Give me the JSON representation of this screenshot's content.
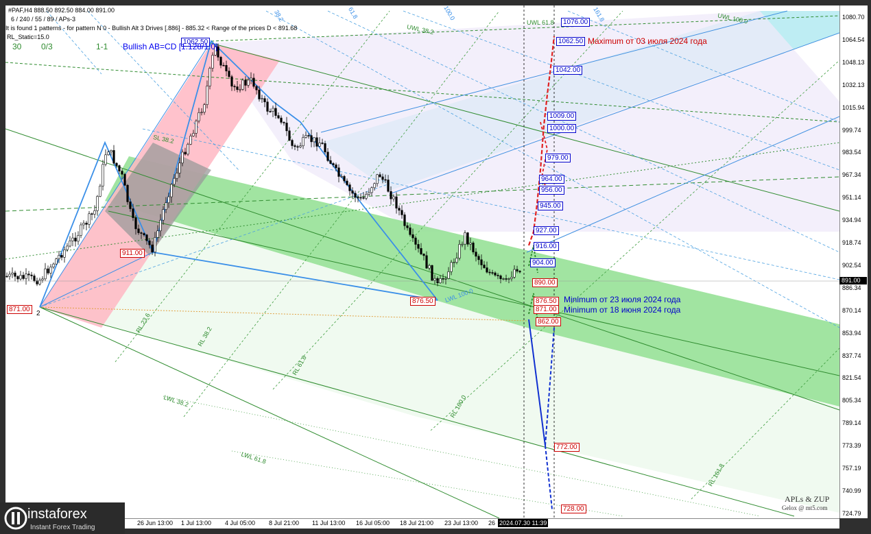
{
  "header": {
    "symbol_line": "#PAF,H4  888.50 892.50 884.00 891.00",
    "settings_line": "6 / 240 / 55 / 89 / APs-3",
    "pattern_line": "It is found 1 patterns  -  for pattern N 0 - Bullish Alt 3 Drives [.886] - 885.32 < Range of the prices D < 891.68",
    "static_line": "RL_Static=15.0",
    "counter_1": "30",
    "counter_2": "0/3",
    "counter_3": "1-1",
    "pattern_title": "Bullish AB=CD [1.128/1.0]"
  },
  "y_axis": {
    "ticks": [
      "1080.70",
      "1064.54",
      "1048.13",
      "1032.13",
      "1015.94",
      "999.74",
      "983.54",
      "967.34",
      "951.14",
      "934.94",
      "918.74",
      "902.54",
      "886.34",
      "870.14",
      "853.94",
      "837.74",
      "821.54",
      "805.34",
      "789.14",
      "773.39",
      "757.19",
      "740.99",
      "724.79"
    ],
    "current_price": "891.00"
  },
  "x_axis": {
    "ticks": [
      "00",
      "26 Jun 13:00",
      "1 Jul 13:00",
      "4 Jul 05:00",
      "8 Jul 21:00",
      "11 Jul 13:00",
      "16 Jul 05:00",
      "18 Jul 21:00",
      "23 Jul 13:00",
      "26"
    ],
    "current_time": "2024.07.30 11:39"
  },
  "levels": {
    "blue": [
      "1076.00",
      "1062.50",
      "1042.00",
      "1009.00",
      "1000.00",
      "979.00",
      "964.00",
      "956.00",
      "945.00",
      "927.00",
      "916.00",
      "904.00"
    ],
    "red": [
      "890.00",
      "876.50",
      "871.00",
      "862.00",
      "772.00",
      "728.00"
    ],
    "chart_marks": [
      "1062.50",
      "911.00",
      "871.00",
      "876.50"
    ],
    "pivot_label": "2"
  },
  "notes": {
    "max_note": "Maximum от 03 июля 2024 года",
    "min_note_1": "Minimum от 23 июля 2024 года",
    "min_note_2": "Minimum от 18 июня 2024 года"
  },
  "line_labels": [
    "UWL 100.0",
    "UWL 61.8",
    "UWL 38.2",
    "SL 38.2",
    "RL 23.6",
    "RL 38.2",
    "RL 61.8",
    "RL 100.0",
    "LWL 38.2",
    "LWL 61.8",
    "LWL 100.0",
    "RL 161.8",
    "61.8",
    "100.0",
    "161.8",
    "38.2"
  ],
  "watermark": {
    "title": "APLs & ZUP",
    "sub": "Gelox @ mt5.com"
  },
  "brand": {
    "name": "instaforex",
    "tagline": "Instant Forex Trading"
  },
  "colors": {
    "blue_level": "#0000cc",
    "red_level": "#cc0000",
    "channel_green": "#6fd36f",
    "channel_cyan": "#8ee3ee",
    "pink_zone": "#ff9fb0",
    "bull_candle": "#ffffff",
    "bear_candle": "#000000"
  },
  "chart_data": {
    "type": "candlestick",
    "symbol": "#PAF",
    "timeframe": "H4",
    "ohlc_last": {
      "open": 888.5,
      "high": 892.5,
      "low": 884.0,
      "close": 891.0
    },
    "ylim": [
      724.79,
      1080.7
    ],
    "swing_points": [
      {
        "date": "18 Jun",
        "value": 871.0
      },
      {
        "date": "25 Jun",
        "value": 911.0
      },
      {
        "date": "3 Jul",
        "value": 1062.5
      },
      {
        "date": "23 Jul",
        "value": 876.5
      }
    ],
    "projection_levels_up": [
      904.0,
      916.0,
      927.0,
      945.0,
      956.0,
      964.0,
      979.0,
      1000.0,
      1009.0,
      1042.0,
      1062.5,
      1076.0
    ],
    "projection_levels_down": [
      890.0,
      876.5,
      871.0,
      862.0,
      772.0,
      728.0
    ]
  }
}
